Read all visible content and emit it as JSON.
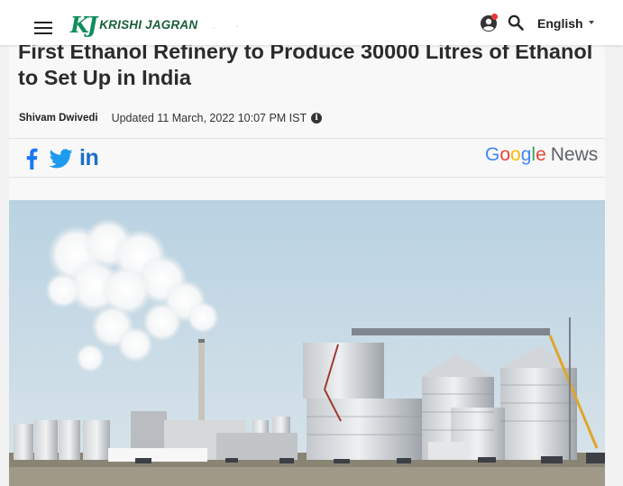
{
  "header": {
    "logo_mark": "KJ",
    "logo_text": "KRISHI JAGRAN",
    "decor_dots": ". ·",
    "language": "English",
    "icons": [
      "menu-icon",
      "user-icon",
      "notification-dot",
      "search-icon",
      "chevron-down-icon"
    ]
  },
  "article": {
    "title": "First Ethanol Refinery to Produce 30000 Litres of Ethanol to Set Up in India",
    "author": "Shivam Dwivedi",
    "updated": "Updated 11 March, 2022 10:07 PM IST",
    "info_glyph": "i"
  },
  "share": {
    "linkedin_label": "in",
    "google_news": {
      "g": "G",
      "o1": "o",
      "o2": "o",
      "g2": "g",
      "l": "l",
      "e": "e",
      "news": "News"
    },
    "google_colors": [
      "#4285F4",
      "#EA4335",
      "#FBBC05",
      "#4285F4",
      "#34A853",
      "#EA4335"
    ],
    "facebook_color": "#1877f2",
    "twitter_color": "#1d9bf0"
  },
  "hero_image": {
    "subject": "ethanol-refinery-photo"
  }
}
